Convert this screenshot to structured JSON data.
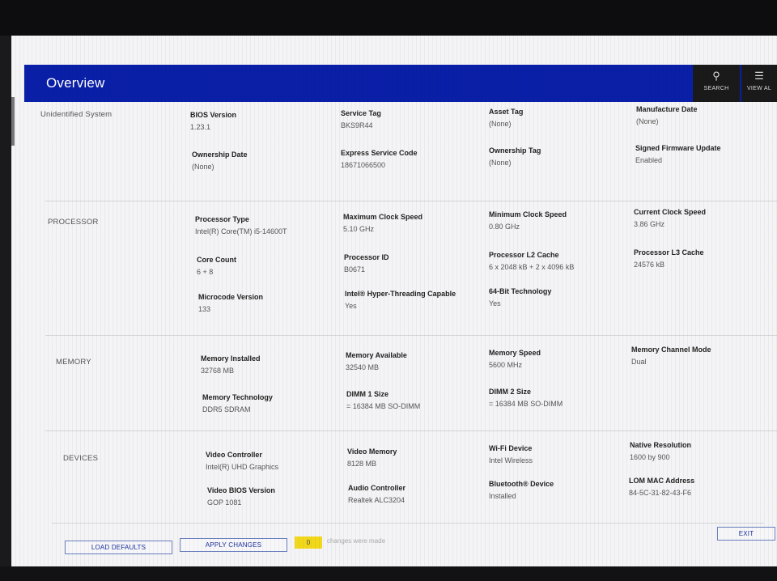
{
  "header": {
    "title": "Overview"
  },
  "toolbar": {
    "search_label": "SEARCH",
    "view_all_label": "VIEW AL"
  },
  "system": {
    "label": "Unidentified System",
    "items": [
      {
        "key": "BIOS Version",
        "value": "1.23.1"
      },
      {
        "key": "Service Tag",
        "value": "BKS9R44"
      },
      {
        "key": "Asset Tag",
        "value": "(None)"
      },
      {
        "key": "Manufacture Date",
        "value": "(None)"
      },
      {
        "key": "Ownership Date",
        "value": "(None)"
      },
      {
        "key": "Express Service Code",
        "value": "18671066500"
      },
      {
        "key": "Ownership Tag",
        "value": "(None)"
      },
      {
        "key": "Signed Firmware Update",
        "value": "Enabled"
      }
    ]
  },
  "processor": {
    "label": "PROCESSOR",
    "items": [
      {
        "key": "Processor Type",
        "value": "Intel(R) Core(TM) i5-14600T"
      },
      {
        "key": "Maximum Clock Speed",
        "value": "5.10 GHz"
      },
      {
        "key": "Minimum Clock Speed",
        "value": "0.80 GHz"
      },
      {
        "key": "Current Clock Speed",
        "value": "3.86 GHz"
      },
      {
        "key": "Core Count",
        "value": "6 + 8"
      },
      {
        "key": "Processor ID",
        "value": "B0671"
      },
      {
        "key": "Processor L2 Cache",
        "value": "6 x 2048  kB + 2 x 4096  kB"
      },
      {
        "key": "Processor L3 Cache",
        "value": "24576 kB"
      },
      {
        "key": "Microcode Version",
        "value": "133"
      },
      {
        "key": "Intel® Hyper-Threading Capable",
        "value": "Yes"
      },
      {
        "key": "64-Bit Technology",
        "value": "Yes"
      }
    ]
  },
  "memory": {
    "label": "MEMORY",
    "items": [
      {
        "key": "Memory Installed",
        "value": "32768 MB"
      },
      {
        "key": "Memory Available",
        "value": "32540 MB"
      },
      {
        "key": "Memory Speed",
        "value": "5600 MHz"
      },
      {
        "key": "Memory Channel Mode",
        "value": "Dual"
      },
      {
        "key": "Memory Technology",
        "value": "DDR5 SDRAM"
      },
      {
        "key": "DIMM 1 Size",
        "value": "= 16384 MB SO-DIMM"
      },
      {
        "key": "DIMM 2 Size",
        "value": "= 16384 MB SO-DIMM"
      }
    ]
  },
  "devices": {
    "label": "DEVICES",
    "items": [
      {
        "key": "Video Controller",
        "value": "Intel(R) UHD Graphics"
      },
      {
        "key": "Video Memory",
        "value": "8128 MB"
      },
      {
        "key": "Wi-Fi Device",
        "value": "Intel Wireless"
      },
      {
        "key": "Native Resolution",
        "value": "1600 by 900"
      },
      {
        "key": "Video BIOS Version",
        "value": "GOP 1081"
      },
      {
        "key": "Audio Controller",
        "value": "Realtek ALC3204"
      },
      {
        "key": "Bluetooth® Device",
        "value": "Installed"
      },
      {
        "key": "LOM MAC Address",
        "value": "84-5C-31-82-43-F6"
      }
    ]
  },
  "footer": {
    "load_defaults": "LOAD DEFAULTS",
    "apply_changes": "APPLY CHANGES",
    "changes_count": "0",
    "changes_msg": "changes were made",
    "exit": "EXIT"
  }
}
